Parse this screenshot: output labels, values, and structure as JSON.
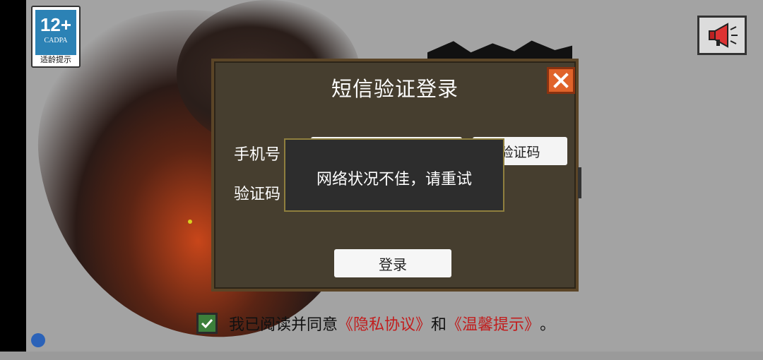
{
  "age_rating": {
    "number": "12+",
    "org": "CADPA",
    "label": "适龄提示"
  },
  "dialog": {
    "title": "短信验证登录",
    "phone_label": "手机号",
    "code_label": "验证码",
    "phone_value": "",
    "get_code_label": "获取验证码",
    "get_code_visible": "验证码",
    "login_label": "登录"
  },
  "toast": {
    "message": "网络状况不佳，请重试"
  },
  "agreement": {
    "prefix": "我已阅读并同意",
    "privacy_link": "《隐私协议》",
    "conjunction": "和",
    "tips_link": "《温馨提示》",
    "suffix": "。",
    "checked": true
  },
  "colors": {
    "accent_orange": "#e0632a",
    "link_red": "#c21d1d",
    "dialog_bg": "#463e2f",
    "checkbox_green": "#3c7f3b"
  }
}
